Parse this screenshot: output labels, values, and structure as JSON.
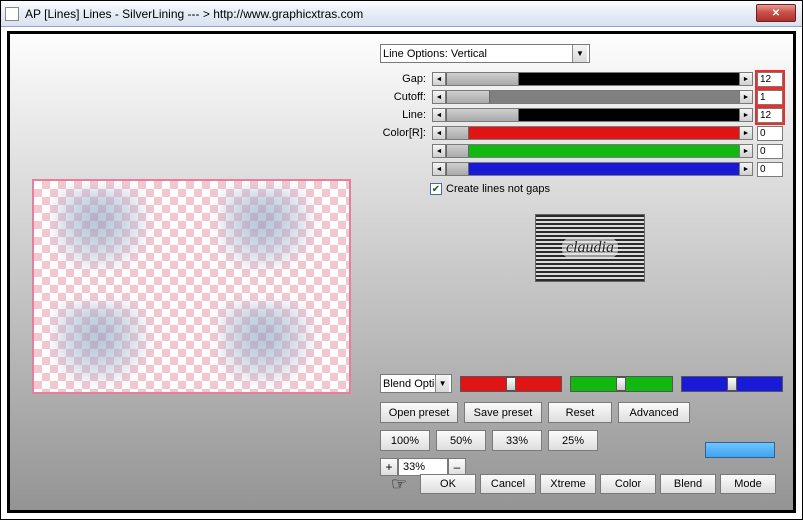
{
  "window": {
    "title": "AP [Lines]  Lines - SilverLining    --- >  http://www.graphicxtras.com"
  },
  "line_options": {
    "selected": "Line Options: Vertical"
  },
  "rows": {
    "gap": {
      "label": "Gap:",
      "value": "12"
    },
    "cutoff": {
      "label": "Cutoff:",
      "value": "1"
    },
    "line": {
      "label": "Line:",
      "value": "12"
    },
    "colorR": {
      "label": "Color[R]:",
      "value": "0"
    },
    "colorG": {
      "label": "",
      "value": "0"
    },
    "colorB": {
      "label": "",
      "value": "0"
    }
  },
  "create_lines_label": "Create lines not gaps",
  "logo_text": "claudia",
  "blend_option_label": "Blend Optio",
  "preset_buttons": {
    "open": "Open preset",
    "save": "Save preset",
    "reset": "Reset",
    "advanced": "Advanced"
  },
  "pct_buttons": {
    "p100": "100%",
    "p50": "50%",
    "p33": "33%",
    "p25": "25%"
  },
  "zoom": {
    "plus": "+",
    "minus": "–",
    "value": "33%"
  },
  "bottom": {
    "ok": "OK",
    "cancel": "Cancel",
    "xtreme": "Xtreme",
    "color": "Color",
    "blend": "Blend",
    "mode": "Mode"
  },
  "colors": {
    "track_black": "#000000",
    "track_gray": "#808080",
    "track_red": "#e01414",
    "track_green": "#10b810",
    "track_blue": "#1919d8"
  }
}
